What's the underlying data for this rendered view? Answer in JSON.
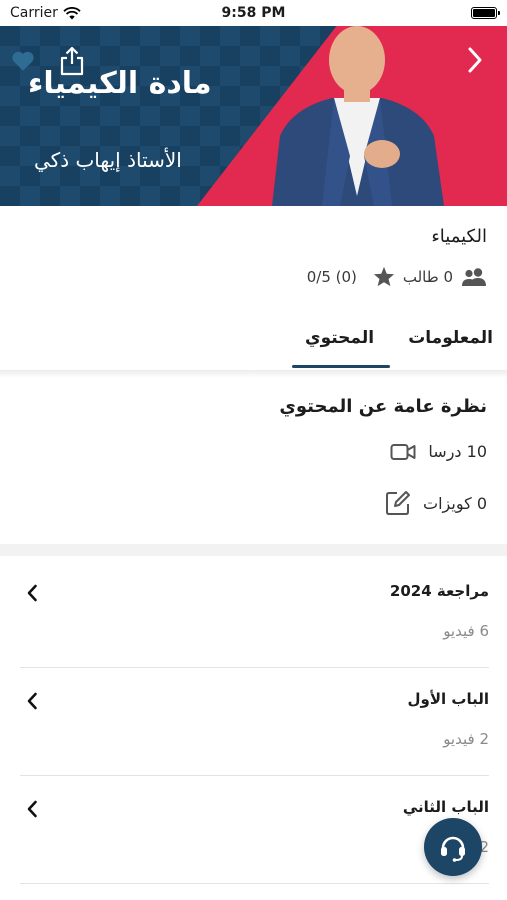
{
  "status_bar": {
    "carrier": "Carrier",
    "time": "9:58 PM"
  },
  "banner": {
    "subject_title": "مادة الكيمياء",
    "teacher_name": "الأستاذ إيهاب ذكي"
  },
  "course": {
    "name": "الكيمياء",
    "students": "0 طالب",
    "rating": "0/5 (0)"
  },
  "tabs": [
    {
      "label": "المعلومات",
      "active": false
    },
    {
      "label": "المحتوي",
      "active": true
    }
  ],
  "overview": {
    "title": "نظرة عامة عن المحتوي",
    "lessons": "10 درسا",
    "quizzes": "0 كويزات"
  },
  "chapters": [
    {
      "title": "مراجعة 2024",
      "count": "6 فيديو"
    },
    {
      "title": "الباب الأول",
      "count": "2 فيديو"
    },
    {
      "title": "الباب الثاني",
      "count": "2 فيديو"
    }
  ],
  "colors": {
    "brand": "#1c4566",
    "accent": "#e2294f"
  },
  "icons": {
    "wifi": "wifi-icon",
    "battery": "battery-icon",
    "heart": "heart-icon",
    "share": "share-icon",
    "back": "chevron-right-icon",
    "students": "people-icon",
    "star": "star-icon",
    "video": "video-camera-icon",
    "quiz": "edit-icon",
    "chevron": "chevron-left-icon",
    "support": "headset-icon"
  }
}
